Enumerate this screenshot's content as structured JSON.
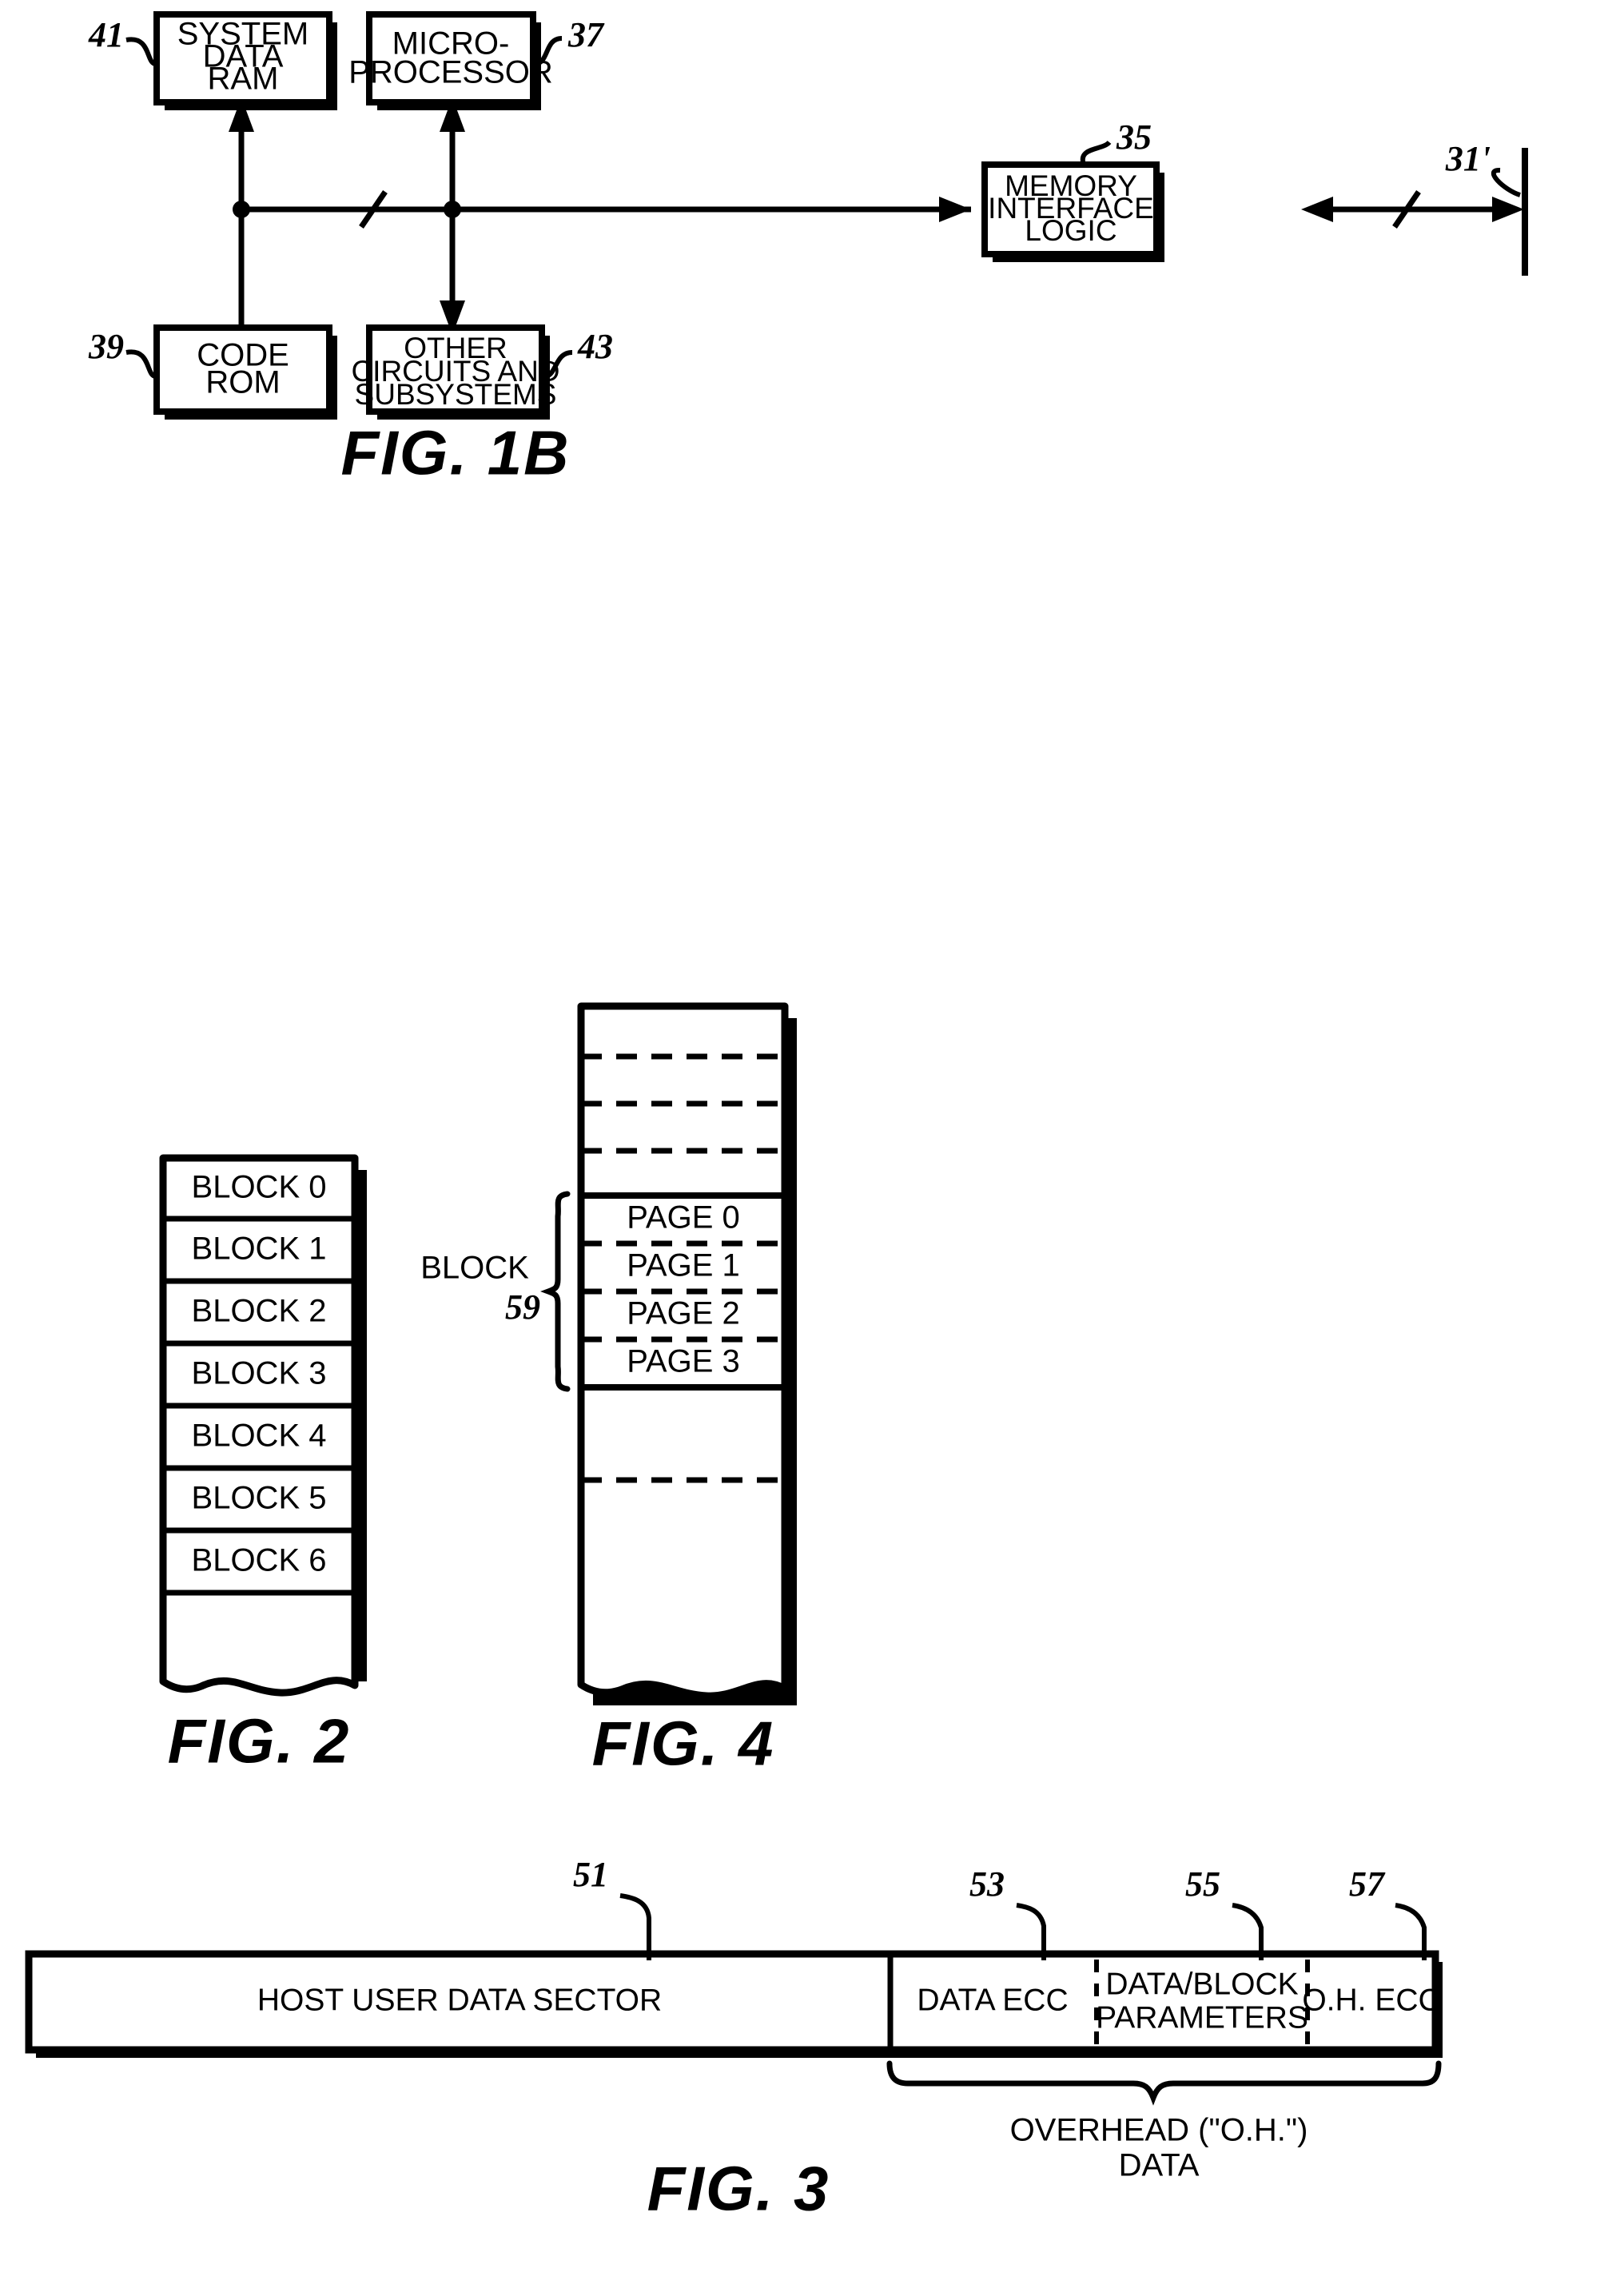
{
  "figures": {
    "fig1b": {
      "label": "FIG. 1B",
      "boxes": [
        {
          "id": "system-data-ram",
          "lines": [
            "SYSTEM",
            "DATA",
            "RAM"
          ],
          "ref": "41"
        },
        {
          "id": "microprocessor",
          "lines": [
            "MICRO-",
            "PROCESSOR"
          ],
          "ref": "37"
        },
        {
          "id": "memory-interface-logic",
          "lines": [
            "MEMORY",
            "INTERFACE",
            "LOGIC"
          ],
          "ref": "35"
        },
        {
          "id": "code-rom",
          "lines": [
            "CODE",
            "ROM"
          ],
          "ref": "39"
        },
        {
          "id": "other-circuits",
          "lines": [
            "OTHER",
            "CIRCUITS AND",
            "SUBSYSTEMS"
          ],
          "ref": "43"
        }
      ],
      "bus_ref": "31'"
    },
    "fig2": {
      "label": "FIG. 2",
      "rows": [
        "BLOCK 0",
        "BLOCK 1",
        "BLOCK 2",
        "BLOCK 3",
        "BLOCK 4",
        "BLOCK 5",
        "BLOCK 6"
      ]
    },
    "fig4": {
      "label": "FIG. 4",
      "bracket_label": "BLOCK",
      "bracket_ref": "59",
      "pages": [
        "PAGE 0",
        "PAGE 1",
        "PAGE 2",
        "PAGE 3"
      ]
    },
    "fig3": {
      "label": "FIG. 3",
      "sections": [
        {
          "id": "host-user-data-sector",
          "text": "HOST USER DATA SECTOR",
          "ref": "51"
        },
        {
          "id": "data-ecc",
          "text": "DATA ECC",
          "ref": "53"
        },
        {
          "id": "data-block-parameters",
          "text_lines": [
            "DATA/BLOCK",
            "PARAMETERS"
          ],
          "ref": "55"
        },
        {
          "id": "oh-ecc",
          "text": "O.H. ECC",
          "ref": "57"
        }
      ],
      "overhead_lines": [
        "OVERHEAD (\"O.H.\")",
        "DATA"
      ]
    }
  },
  "colors": {
    "ink": "#000000",
    "paper": "#ffffff"
  }
}
